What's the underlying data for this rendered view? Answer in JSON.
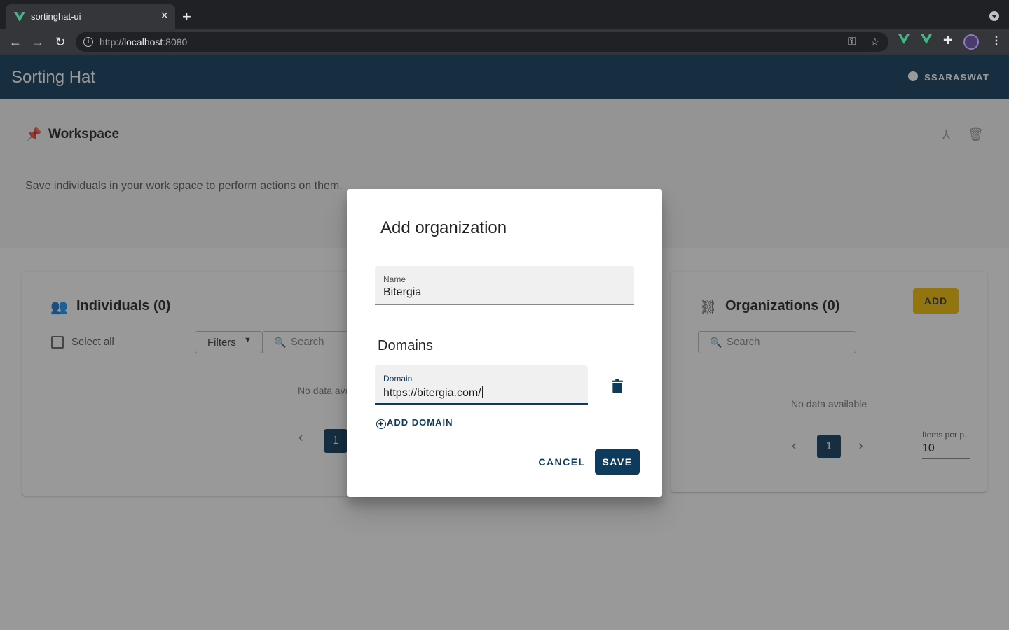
{
  "browser": {
    "tab_title": "sortinghat-ui",
    "url_prefix": "http://",
    "url_host": "localhost",
    "url_port": ":8080"
  },
  "appbar": {
    "title": "Sorting Hat",
    "user": "SSARASWAT"
  },
  "workspace": {
    "title": "Workspace",
    "description": "Save individuals in your work space to perform actions on them."
  },
  "individuals": {
    "title": "Individuals (0)",
    "select_all": "Select all",
    "filters": "Filters",
    "search_placeholder": "Search",
    "no_data": "No data avai",
    "page": "1"
  },
  "organizations": {
    "title": "Organizations (0)",
    "add_label": "ADD",
    "search_placeholder": "Search",
    "no_data": "No data available",
    "page": "1",
    "items_per_page_label": "Items per p...",
    "items_per_page_value": "10"
  },
  "dialog": {
    "title": "Add organization",
    "name_label": "Name",
    "name_value": "Bitergia",
    "domains_title": "Domains",
    "domain_label": "Domain",
    "domain_value": "https://bitergia.com/",
    "add_domain": "ADD DOMAIN",
    "cancel": "CANCEL",
    "save": "SAVE"
  },
  "colors": {
    "primary": "#0e3a5c",
    "accent": "#f4bc00",
    "vue_green": "#41b883"
  }
}
